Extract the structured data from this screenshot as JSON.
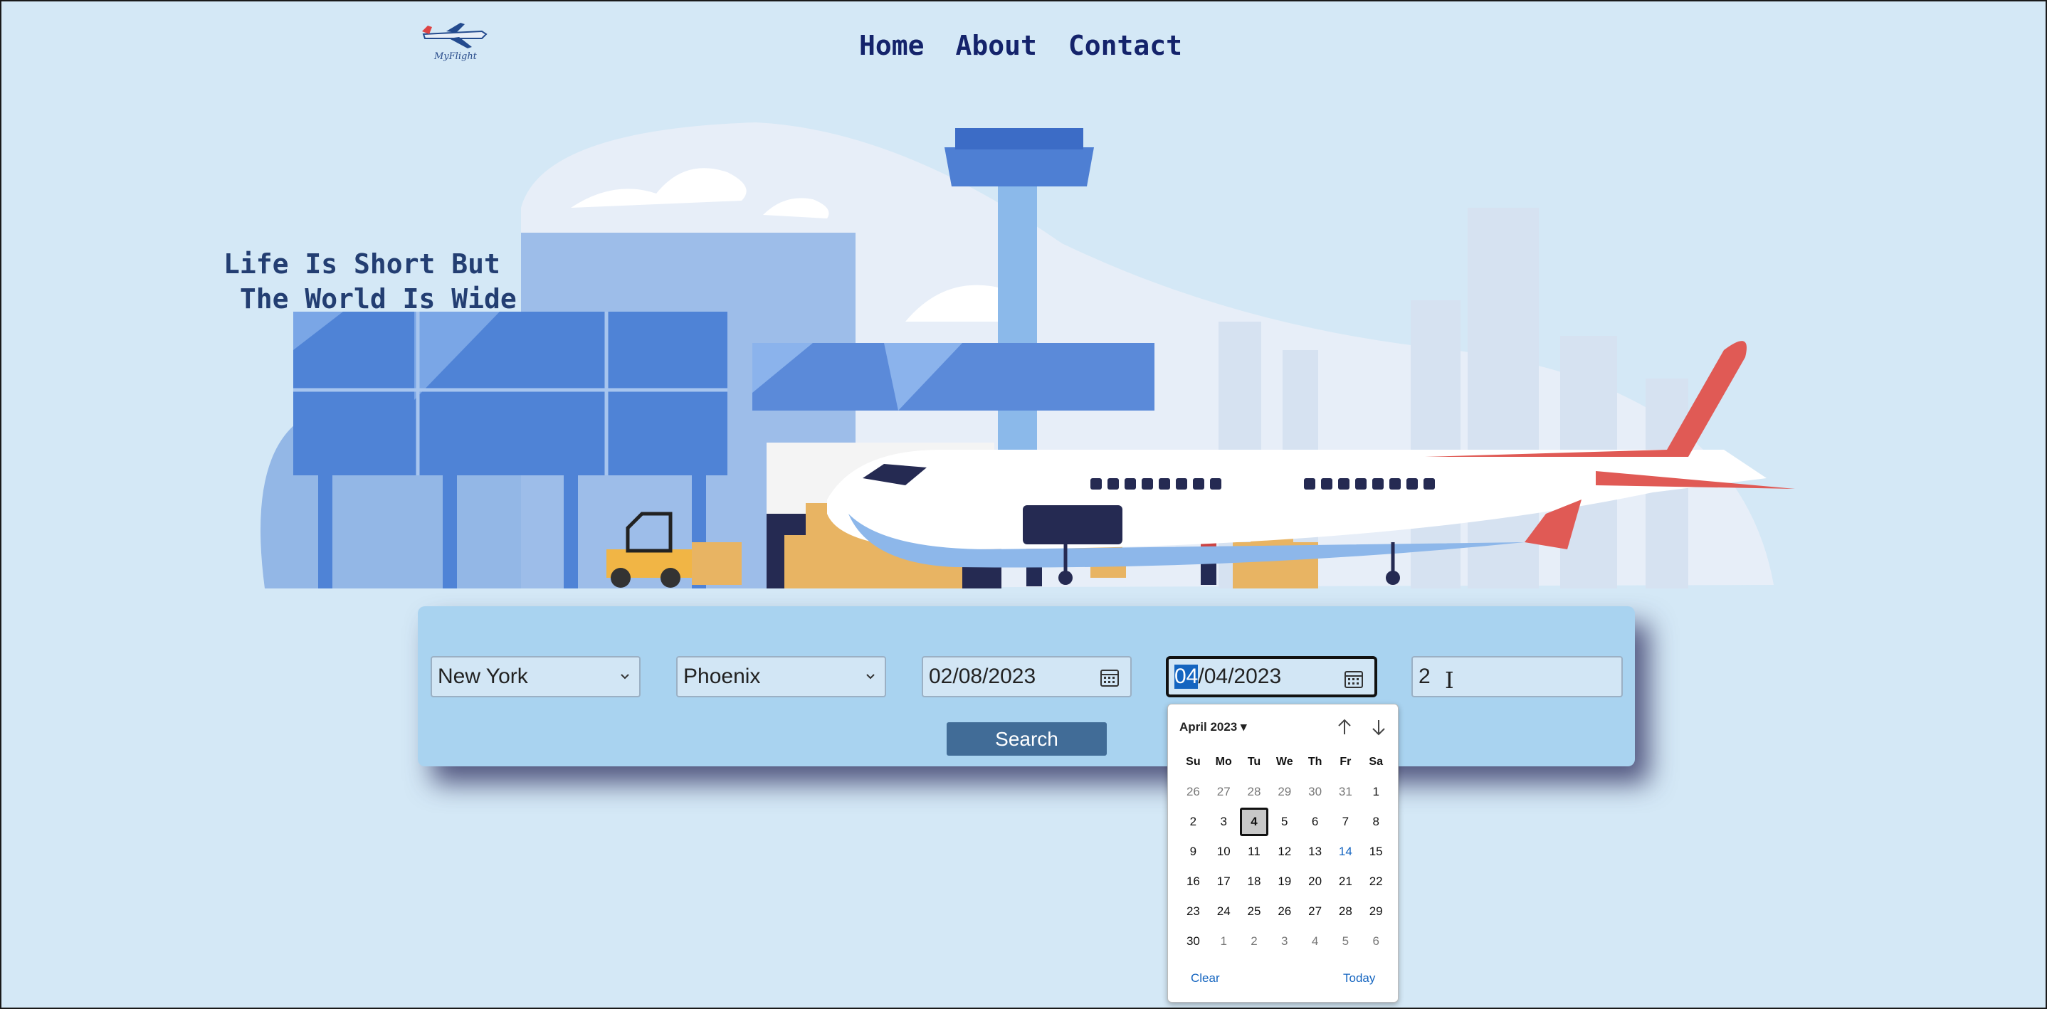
{
  "logo": {
    "text": "MyFlight"
  },
  "nav": {
    "home": "Home",
    "about": "About",
    "contact": "Contact"
  },
  "hero": {
    "tagline": "Life Is Short But\n The World Is Wide"
  },
  "search": {
    "from": "New York",
    "to": "Phoenix",
    "depart_date": "02/08/2023",
    "return_date_selected_part": "04",
    "return_date_rest": "/04/2023",
    "passengers": "2",
    "button_label": "Search"
  },
  "calendar": {
    "month_label": "April 2023 ▾",
    "weekdays": [
      "Su",
      "Mo",
      "Tu",
      "We",
      "Th",
      "Fr",
      "Sa"
    ],
    "weeks": [
      [
        "26",
        "27",
        "28",
        "29",
        "30",
        "31",
        "1"
      ],
      [
        "2",
        "3",
        "4",
        "5",
        "6",
        "7",
        "8"
      ],
      [
        "9",
        "10",
        "11",
        "12",
        "13",
        "14",
        "15"
      ],
      [
        "16",
        "17",
        "18",
        "19",
        "20",
        "21",
        "22"
      ],
      [
        "23",
        "24",
        "25",
        "26",
        "27",
        "28",
        "29"
      ],
      [
        "30",
        "1",
        "2",
        "3",
        "4",
        "5",
        "6"
      ]
    ],
    "selected_day": "4",
    "highlight_day": "14",
    "clear_label": "Clear",
    "today_label": "Today"
  },
  "colors": {
    "background": "#d4e8f6",
    "nav_text": "#14236b",
    "panel": "#a9d3f0",
    "button": "#416c97",
    "accent_red": "#e05a55"
  }
}
